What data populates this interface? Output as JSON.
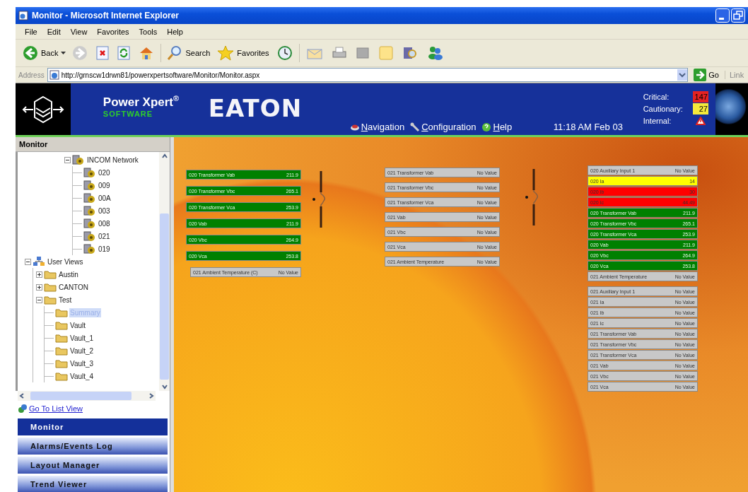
{
  "window": {
    "title": "Monitor - Microsoft Internet Explorer"
  },
  "menu": [
    "File",
    "Edit",
    "View",
    "Favorites",
    "Tools",
    "Help"
  ],
  "toolbar": {
    "back": "Back",
    "search": "Search",
    "favorites": "Favorites"
  },
  "address_bar": {
    "label": "Address",
    "value": "http://grnscw1drwn81/powerxpertsoftware/Monitor/Monitor.aspx",
    "go": "Go",
    "links": "Link"
  },
  "header": {
    "product": "Power Xpert$^{®}$",
    "subtitle": "SOFTWARE",
    "brand": "EATON",
    "nav": [
      {
        "label": "Navigation",
        "kind": "nav"
      },
      {
        "label": "Configuration",
        "kind": "config"
      },
      {
        "label": "Help",
        "kind": "help"
      }
    ],
    "time": "11:18 AM Feb 03",
    "alarms": [
      {
        "label": "Critical:",
        "count": "147",
        "color": "#e52222"
      },
      {
        "label": "Cautionary:",
        "count": "27",
        "color": "#f5e93a"
      },
      {
        "label": "Internal:",
        "kind": "warning"
      }
    ]
  },
  "sidebar": {
    "title": "Monitor",
    "tree": [
      {
        "label": "INCOM Network",
        "kind": "device",
        "expanded": true,
        "selected": false,
        "children": [
          {
            "label": "020",
            "kind": "device",
            "selected": false
          },
          {
            "label": "009",
            "kind": "device",
            "selected": false
          },
          {
            "label": "00A",
            "kind": "device",
            "selected": false
          },
          {
            "label": "003",
            "kind": "device",
            "selected": false
          },
          {
            "label": "008",
            "kind": "device",
            "selected": false
          },
          {
            "label": "021",
            "kind": "device",
            "selected": false
          },
          {
            "label": "019",
            "kind": "device",
            "selected": false
          }
        ]
      },
      {
        "label": "User Views",
        "kind": "views",
        "expanded": true,
        "selected": false,
        "children": [
          {
            "label": "Austin",
            "kind": "folder",
            "expanded": false,
            "selected": false
          },
          {
            "label": "CANTON",
            "kind": "folder",
            "expanded": false,
            "selected": false
          },
          {
            "label": "Test",
            "kind": "folder",
            "expanded": true,
            "selected": false,
            "children": [
              {
                "label": "Summary",
                "kind": "folder",
                "selected": true
              },
              {
                "label": "Vault",
                "kind": "folder",
                "selected": false
              },
              {
                "label": "Vault_1",
                "kind": "folder",
                "selected": false
              },
              {
                "label": "Vault_2",
                "kind": "folder",
                "selected": false
              },
              {
                "label": "Vault_3",
                "kind": "folder",
                "selected": false
              },
              {
                "label": "Vault_4",
                "kind": "folder",
                "selected": false
              }
            ]
          }
        ]
      }
    ],
    "list_view_link": "Go To List View",
    "nav_buttons": [
      {
        "label": "Monitor",
        "selected": true
      },
      {
        "label": "Alarms/Events Log",
        "selected": false
      },
      {
        "label": "Layout Manager",
        "selected": false
      },
      {
        "label": "Trend Viewer",
        "selected": false
      }
    ]
  },
  "panels": [
    {
      "breaker": true,
      "rows": [
        {
          "label": "020 Transformer Vab",
          "reading": "211.9",
          "color": "#008000"
        },
        {
          "label": "020 Transformer Vbc",
          "reading": "265.1",
          "color": "#008000"
        },
        {
          "label": "020 Transformer Vca",
          "reading": "253.9",
          "color": "#008000"
        },
        {
          "label": "020 Vab",
          "reading": "211.9",
          "color": "#008000"
        },
        {
          "label": "020 Vbc",
          "reading": "264.9",
          "color": "#008000"
        },
        {
          "label": "020 Vca",
          "reading": "253.8",
          "color": "#008000"
        },
        {
          "label": "021 Ambient Temperature (C)",
          "reading": "No Value",
          "color": "#c8c8c8"
        }
      ]
    },
    {
      "breaker": true,
      "rows": [
        {
          "label": "021 Transformer Vab",
          "reading": "No Value",
          "color": "#c8c8c8"
        },
        {
          "label": "021 Transformer Vbc",
          "reading": "No Value",
          "color": "#c8c8c8"
        },
        {
          "label": "021 Transformer Vca",
          "reading": "No Value",
          "color": "#c8c8c8"
        },
        {
          "label": "021 Vab",
          "reading": "No Value",
          "color": "#c8c8c8"
        },
        {
          "label": "021 Vbc",
          "reading": "No Value",
          "color": "#c8c8c8"
        },
        {
          "label": "021 Vca",
          "reading": "No Value",
          "color": "#c8c8c8"
        },
        {
          "label": "021 Ambient Temperature",
          "reading": "No Value",
          "color": "#c8c8c8"
        }
      ]
    },
    {
      "breaker": false,
      "rows": [
        {
          "label": "020 Auxiliary Input 1",
          "reading": "No Value",
          "color": "#c8c8c8"
        },
        {
          "label": "020 Ia",
          "reading": "14",
          "color": "#ffff00"
        },
        {
          "label": "020 Ib",
          "reading": "30",
          "color": "#ff0000"
        },
        {
          "label": "020 Ic",
          "reading": "44.49",
          "color": "#ff0000"
        },
        {
          "label": "020 Transformer Vab",
          "reading": "211.9",
          "color": "#008000"
        },
        {
          "label": "020 Transformer Vbc",
          "reading": "265.1",
          "color": "#008000"
        },
        {
          "label": "020 Transformer Vca",
          "reading": "253.9",
          "color": "#008000"
        },
        {
          "label": "020 Vab",
          "reading": "211.9",
          "color": "#008000"
        },
        {
          "label": "020 Vbc",
          "reading": "264.9",
          "color": "#008000"
        },
        {
          "label": "020 Vca",
          "reading": "253.8",
          "color": "#008000"
        },
        {
          "label": "021 Ambient Temperature",
          "reading": "No Value",
          "color": "#c8c8c8"
        }
      ]
    },
    {
      "breaker": false,
      "rows": [
        {
          "label": "021 Auxiliary Input 1",
          "reading": "No Value",
          "color": "#c8c8c8"
        },
        {
          "label": "021 Ia",
          "reading": "No Value",
          "color": "#c8c8c8"
        },
        {
          "label": "021 Ib",
          "reading": "No Value",
          "color": "#c8c8c8"
        },
        {
          "label": "021 Ic",
          "reading": "No Value",
          "color": "#c8c8c8"
        },
        {
          "label": "021 Transformer Vab",
          "reading": "No Value",
          "color": "#c8c8c8"
        },
        {
          "label": "021 Transformer Vbc",
          "reading": "No Value",
          "color": "#c8c8c8"
        },
        {
          "label": "021 Transformer Vca",
          "reading": "No Value",
          "color": "#c8c8c8"
        },
        {
          "label": "021 Vab",
          "reading": "No Value",
          "color": "#c8c8c8"
        },
        {
          "label": "021 Vbc",
          "reading": "No Value",
          "color": "#c8c8c8"
        },
        {
          "label": "021 Vca",
          "reading": "No Value",
          "color": "#c8c8c8"
        }
      ]
    }
  ]
}
